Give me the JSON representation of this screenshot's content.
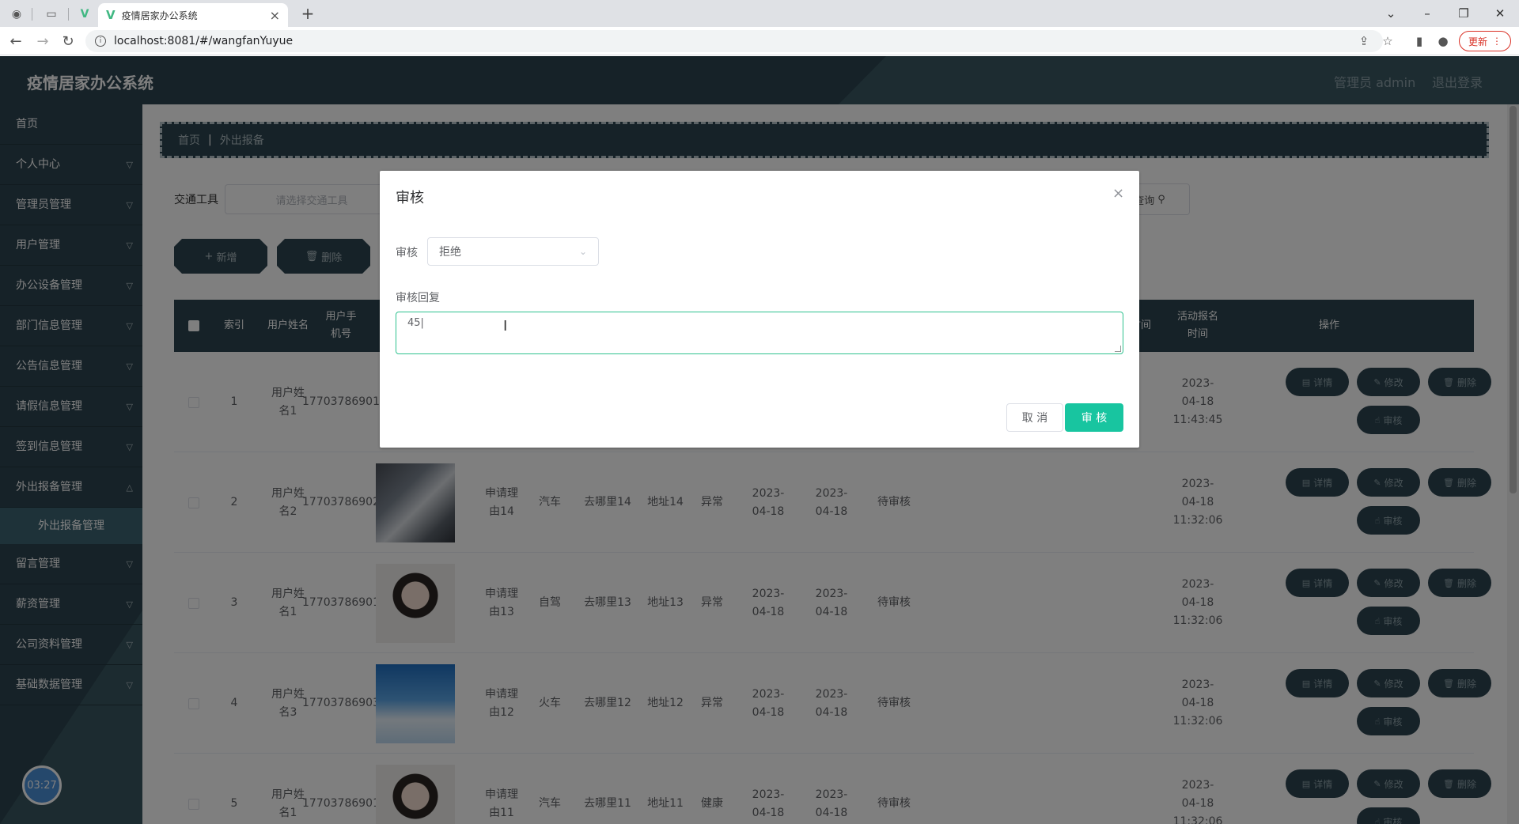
{
  "browser": {
    "tab_title": "疫情居家办公系统",
    "url": "localhost:8081/#/wangfanYuyue",
    "update_label": "更新"
  },
  "header": {
    "app_title": "疫情居家办公系统",
    "user_label": "管理员 admin",
    "logout_label": "退出登录"
  },
  "sidebar": {
    "items": [
      {
        "label": "首页"
      },
      {
        "label": "个人中心"
      },
      {
        "label": "管理员管理"
      },
      {
        "label": "用户管理"
      },
      {
        "label": "办公设备管理"
      },
      {
        "label": "部门信息管理"
      },
      {
        "label": "公告信息管理"
      },
      {
        "label": "请假信息管理"
      },
      {
        "label": "签到信息管理"
      },
      {
        "label": "外出报备管理"
      },
      {
        "label": "留言管理"
      },
      {
        "label": "薪资管理"
      },
      {
        "label": "公司资料管理"
      },
      {
        "label": "基础数据管理"
      }
    ],
    "active_sub": "外出报备管理",
    "timer": "03:27"
  },
  "breadcrumb": {
    "home": "首页",
    "current": "外出报备"
  },
  "search": {
    "label": "交通工具",
    "placeholder": "请选择交通工具",
    "query_label": "查询"
  },
  "actions": {
    "add_label": "新增",
    "delete_label": "删除"
  },
  "table": {
    "headers": {
      "index": "索引",
      "user_name": "用户姓名",
      "phone": "用户手机号",
      "time_partial": "时间",
      "signup_time": "活动报名时间",
      "ops": "操作"
    },
    "rows": [
      {
        "index": "1",
        "name": "用户姓名1",
        "phone": "17703786901",
        "reason": "",
        "transport": "",
        "dest": "",
        "addr": "",
        "health": "",
        "d1": "",
        "d2": "",
        "status": "",
        "signup": "2023-04-18 11:43:45"
      },
      {
        "index": "2",
        "name": "用户姓名2",
        "phone": "17703786902",
        "reason": "申请理由14",
        "transport": "汽车",
        "dest": "去哪里14",
        "addr": "地址14",
        "health": "异常",
        "d1": "2023-04-18",
        "d2": "2023-04-18",
        "status": "待审核",
        "signup": "2023-04-18 11:32:06"
      },
      {
        "index": "3",
        "name": "用户姓名1",
        "phone": "17703786901",
        "reason": "申请理由13",
        "transport": "自驾",
        "dest": "去哪里13",
        "addr": "地址13",
        "health": "异常",
        "d1": "2023-04-18",
        "d2": "2023-04-18",
        "status": "待审核",
        "signup": "2023-04-18 11:32:06"
      },
      {
        "index": "4",
        "name": "用户姓名3",
        "phone": "17703786903",
        "reason": "申请理由12",
        "transport": "火车",
        "dest": "去哪里12",
        "addr": "地址12",
        "health": "异常",
        "d1": "2023-04-18",
        "d2": "2023-04-18",
        "status": "待审核",
        "signup": "2023-04-18 11:32:06"
      },
      {
        "index": "5",
        "name": "用户姓名1",
        "phone": "17703786901",
        "reason": "申请理由11",
        "transport": "汽车",
        "dest": "去哪里11",
        "addr": "地址11",
        "health": "健康",
        "d1": "2023-04-18",
        "d2": "2023-04-18",
        "status": "待审核",
        "signup": "2023-04-18 11:32:06"
      }
    ],
    "op_labels": {
      "detail": "详情",
      "edit": "修改",
      "delete": "删除",
      "audit": "审核"
    }
  },
  "dialog": {
    "title": "审核",
    "audit_label": "审核",
    "audit_value": "拒绝",
    "reply_label": "审核回复",
    "reply_value": "45",
    "cancel_label": "取 消",
    "confirm_label": "审 核"
  },
  "colors": {
    "sidebar_bg": "#2d4550",
    "accent": "#18c5a0",
    "update_red": "#d93025"
  }
}
